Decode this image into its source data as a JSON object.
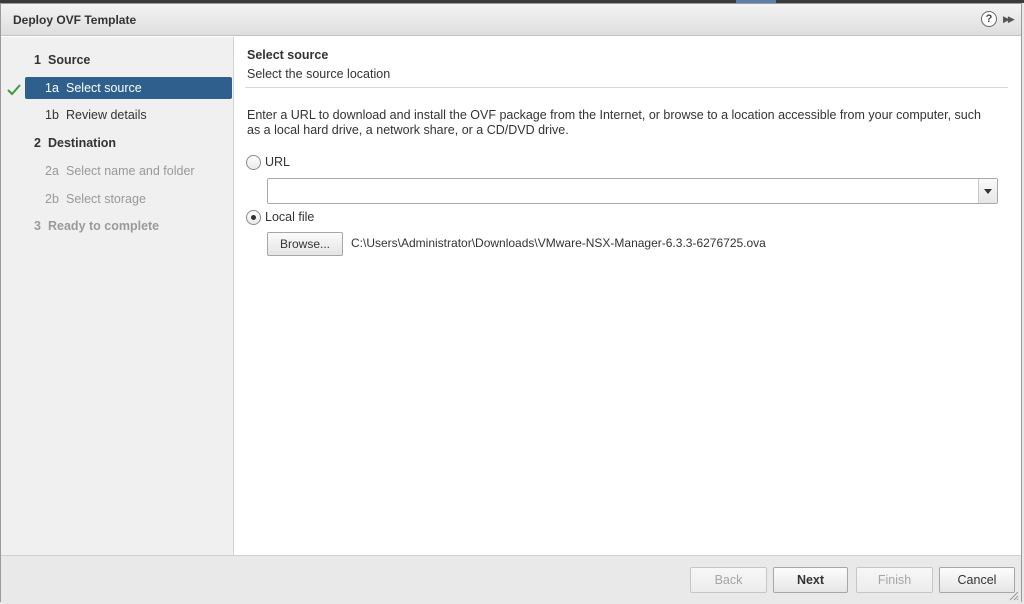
{
  "window": {
    "title": "Deploy OVF Template",
    "help_glyph": "?",
    "expand_glyph": "▶▶"
  },
  "icons": {
    "help": "help-icon",
    "expand": "expand-icon",
    "check": "check-icon",
    "dropdown": "chevron-down-icon",
    "resize": "resize-grip-icon"
  },
  "colors": {
    "selected_step": "#2f5f8d",
    "check": "#3c9a3c"
  },
  "steps": [
    {
      "num": "1",
      "label": "Source"
    },
    {
      "num": "1a",
      "label": "Select source"
    },
    {
      "num": "1b",
      "label": "Review details"
    },
    {
      "num": "2",
      "label": "Destination"
    },
    {
      "num": "2a",
      "label": "Select name and folder"
    },
    {
      "num": "2b",
      "label": "Select storage"
    },
    {
      "num": "3",
      "label": "Ready to complete"
    }
  ],
  "page": {
    "title": "Select source",
    "subtitle": "Select the source location",
    "description": "Enter a URL to download and install the OVF package from the Internet, or browse to a location accessible from your computer, such as a local hard drive, a network share, or a CD/DVD drive."
  },
  "source": {
    "url_label": "URL",
    "url_value": "",
    "local_label": "Local file",
    "browse_label": "Browse...",
    "file_path": "C:\\Users\\Administrator\\Downloads\\VMware-NSX-Manager-6.3.3-6276725.ova"
  },
  "footer": {
    "back": "Back",
    "next": "Next",
    "finish": "Finish",
    "cancel": "Cancel"
  }
}
